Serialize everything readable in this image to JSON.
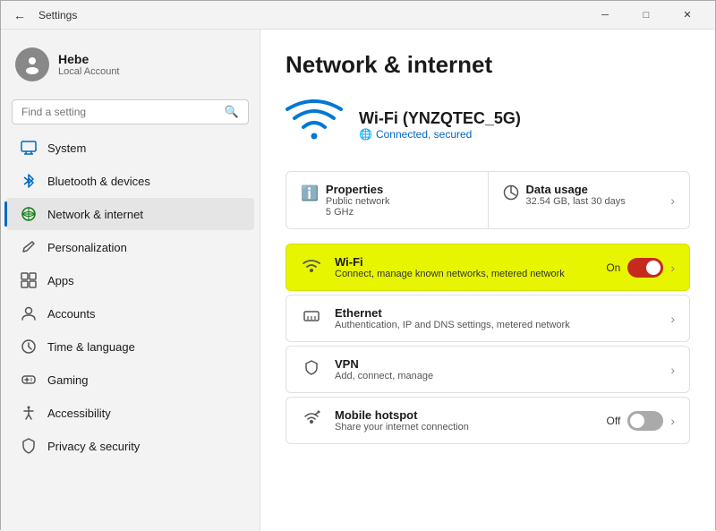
{
  "titlebar": {
    "back_label": "←",
    "title": "Settings",
    "btn_minimize": "─",
    "btn_maximize": "□",
    "btn_close": "✕"
  },
  "user": {
    "name": "Hebe",
    "subtitle": "Local Account"
  },
  "search": {
    "placeholder": "Find a setting"
  },
  "nav_items": [
    {
      "id": "system",
      "label": "System",
      "icon": "🖥",
      "active": false
    },
    {
      "id": "bluetooth",
      "label": "Bluetooth & devices",
      "icon": "🔷",
      "active": false
    },
    {
      "id": "network",
      "label": "Network & internet",
      "icon": "🌐",
      "active": true
    },
    {
      "id": "personalization",
      "label": "Personalization",
      "icon": "✏️",
      "active": false
    },
    {
      "id": "apps",
      "label": "Apps",
      "icon": "📦",
      "active": false
    },
    {
      "id": "accounts",
      "label": "Accounts",
      "icon": "👤",
      "active": false
    },
    {
      "id": "time",
      "label": "Time & language",
      "icon": "🕐",
      "active": false
    },
    {
      "id": "gaming",
      "label": "Gaming",
      "icon": "🎮",
      "active": false
    },
    {
      "id": "accessibility",
      "label": "Accessibility",
      "icon": "♿",
      "active": false
    },
    {
      "id": "privacy",
      "label": "Privacy & security",
      "icon": "🛡",
      "active": false
    }
  ],
  "page_title": "Network & internet",
  "wifi_header": {
    "name": "Wi-Fi (YNZQTEC_5G)",
    "status": "Connected, secured"
  },
  "info_cards": [
    {
      "title": "Properties",
      "sub_lines": [
        "Public network",
        "5 GHz"
      ],
      "icon": "ℹ",
      "has_chevron": false
    },
    {
      "title": "Data usage",
      "sub_lines": [
        "32.54 GB, last 30 days"
      ],
      "icon": "📊",
      "has_chevron": true
    }
  ],
  "settings_rows": [
    {
      "id": "wifi",
      "icon": "wifi",
      "title": "Wi-Fi",
      "sub": "Connect, manage known networks, metered network",
      "right_type": "toggle_on",
      "right_label": "On",
      "highlighted": true
    },
    {
      "id": "ethernet",
      "icon": "ethernet",
      "title": "Ethernet",
      "sub": "Authentication, IP and DNS settings, metered network",
      "right_type": "chevron",
      "highlighted": false
    },
    {
      "id": "vpn",
      "icon": "vpn",
      "title": "VPN",
      "sub": "Add, connect, manage",
      "right_type": "chevron",
      "highlighted": false
    },
    {
      "id": "hotspot",
      "icon": "hotspot",
      "title": "Mobile hotspot",
      "sub": "Share your internet connection",
      "right_type": "toggle_off",
      "right_label": "Off",
      "highlighted": false
    }
  ]
}
